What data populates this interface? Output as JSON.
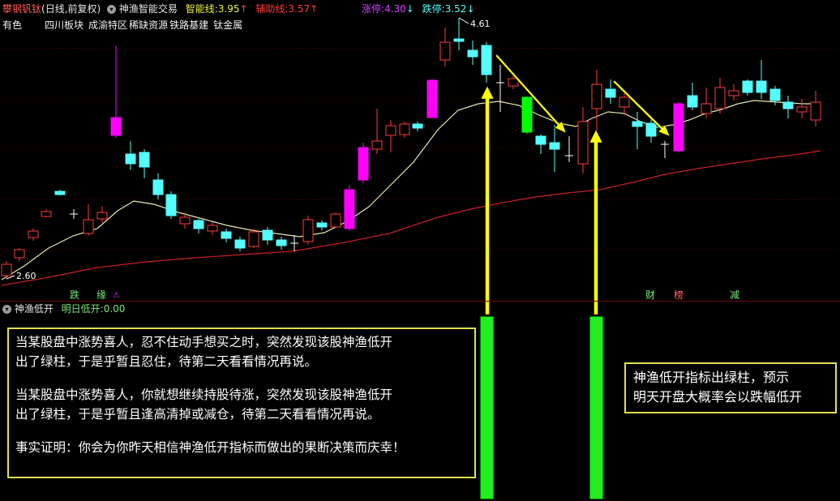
{
  "header": {
    "name": "攀钢钒钛",
    "period": "(日线,前复权)",
    "indicator_name": "神渔智能交易",
    "smart_line_label": "智能线:",
    "smart_line_value": "3.95",
    "smart_line_arrow": "↑",
    "aux_line_label": "辅助线:",
    "aux_line_value": "3.57",
    "aux_line_arrow": "↑",
    "limit_up_label": "涨停:",
    "limit_up_value": "4.30",
    "limit_up_arrow": "↓",
    "limit_down_label": "跌停:",
    "limit_down_value": "3.52",
    "limit_down_arrow": "↓"
  },
  "tags": [
    "有色",
    "四川板块",
    "成渝特区",
    "稀缺资源",
    "铁路基建",
    "钛金属"
  ],
  "price_labels": {
    "high": "4.61",
    "low": "2.60"
  },
  "events": [
    {
      "text": "跌",
      "color": "#79e879"
    },
    {
      "text": "缘",
      "color": "#79e879"
    },
    {
      "text": "财",
      "color": "#79e879"
    },
    {
      "text": "榜",
      "color": "#ff6a6a"
    },
    {
      "text": "减",
      "color": "#79e879"
    }
  ],
  "sub_panel": {
    "name": "神渔低开",
    "field_label": "明日低开:",
    "field_value": "0.00"
  },
  "colors": {
    "up": "#ff3b3b",
    "down": "#54ffff",
    "signal_up": "#ff00ff",
    "signal_down": "#00ff00",
    "ma_short": "#e8e8b0",
    "ma_long": "#c8202a",
    "arrow": "#ffff00",
    "annotation_border": "#e3e04c"
  },
  "notes": {
    "left": [
      "当某股盘中涨势喜人，忍不住动手想买之时，突然发现该股神渔低开",
      "出了绿柱，于是乎暂且忍住，待第二天看看情况再说。",
      "当某股盘中涨势喜人，你就想继续持股待涨，突然发现该股神渔低开",
      "出了绿柱，于是乎暂且逢高清掉或减仓，待第二天看看情况再说。",
      "事实证明：你会为你昨天相信神渔低开指标而做出的果断决策而庆幸！"
    ],
    "right": [
      "神渔低开指标出绿柱，预示",
      "明天开盘大概率会以跌幅低开"
    ]
  }
}
